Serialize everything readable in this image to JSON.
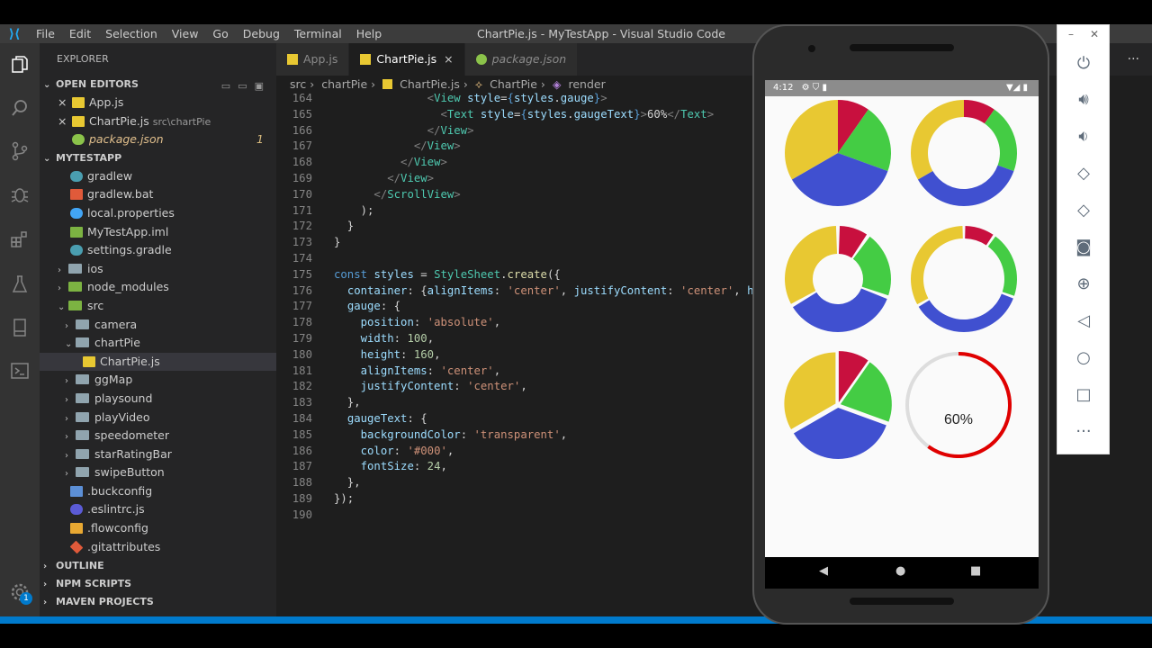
{
  "titlebar": {
    "menu": [
      "File",
      "Edit",
      "Selection",
      "View",
      "Go",
      "Debug",
      "Terminal",
      "Help"
    ],
    "title": "ChartPie.js - MyTestApp - Visual Studio Code"
  },
  "sidebar": {
    "header": "EXPLORER",
    "open_editors_label": "OPEN EDITORS",
    "open_editors": [
      {
        "name": "App.js",
        "desc": "",
        "badge": ""
      },
      {
        "name": "ChartPie.js",
        "desc": "src\\chartPie",
        "badge": ""
      },
      {
        "name": "package.json",
        "desc": "",
        "badge": "1"
      }
    ],
    "project_label": "MYTESTAPP",
    "files": [
      {
        "name": "gradlew"
      },
      {
        "name": "gradlew.bat"
      },
      {
        "name": "local.properties"
      },
      {
        "name": "MyTestApp.iml"
      },
      {
        "name": "settings.gradle"
      },
      {
        "name": "ios"
      },
      {
        "name": "node_modules"
      },
      {
        "name": "src"
      },
      {
        "name": "camera"
      },
      {
        "name": "chartPie"
      },
      {
        "name": "ChartPie.js"
      },
      {
        "name": "ggMap"
      },
      {
        "name": "playsound"
      },
      {
        "name": "playVideo"
      },
      {
        "name": "speedometer"
      },
      {
        "name": "starRatingBar"
      },
      {
        "name": "swipeButton"
      },
      {
        "name": ".buckconfig"
      },
      {
        "name": ".eslintrc.js"
      },
      {
        "name": ".flowconfig"
      },
      {
        "name": ".gitattributes"
      }
    ],
    "outline_label": "OUTLINE",
    "npm_label": "NPM SCRIPTS",
    "maven_label": "MAVEN PROJECTS"
  },
  "tabs": [
    {
      "label": "App.js"
    },
    {
      "label": "ChartPie.js",
      "close": "×"
    },
    {
      "label": "package.json"
    }
  ],
  "tab_more": "···",
  "breadcrumb": [
    "src",
    "chartPie",
    "ChartPie.js",
    "ChartPie",
    "render"
  ],
  "code_lines": {
    "n164": "164",
    "n165": "165",
    "n166": "166",
    "n167": "167",
    "n168": "168",
    "n169": "169",
    "n170": "170",
    "n171": "171",
    "n172": "172",
    "n173": "173",
    "n174": "174",
    "n175": "175",
    "n176": "176",
    "n177": "177",
    "n178": "178",
    "n179": "179",
    "n180": "180",
    "n181": "181",
    "n182": "182",
    "n183": "183",
    "n184": "184",
    "n185": "185",
    "n186": "186",
    "n187": "187",
    "n188": "188",
    "n189": "189",
    "n190": "190"
  },
  "phone": {
    "time": "4:12",
    "gauge_text": "60%",
    "gauge_progress": 0.6
  },
  "pies": {
    "colors": {
      "red": "#c8103e",
      "green": "#44cc44",
      "blue": "#4050d0",
      "yellow": "#e8c832"
    }
  },
  "activity_badge": "1"
}
